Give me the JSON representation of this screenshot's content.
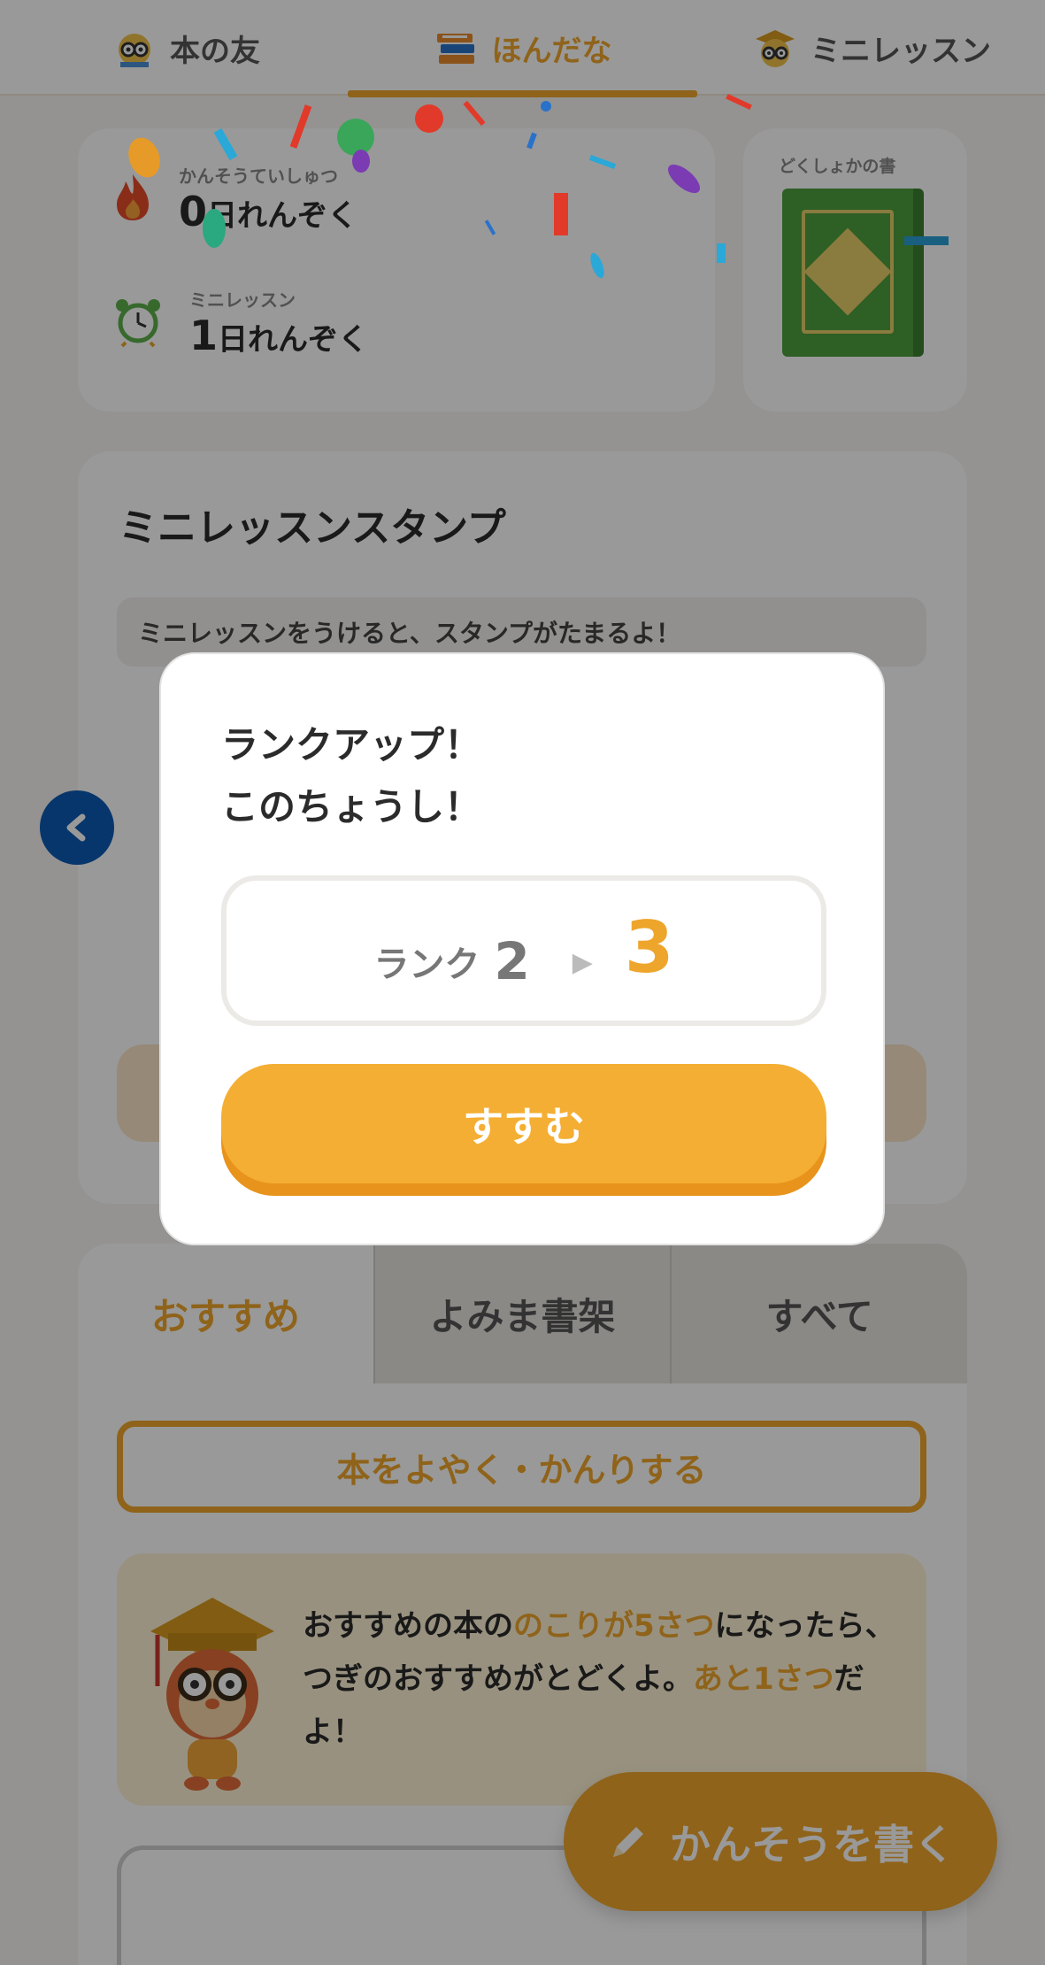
{
  "topnav": {
    "tabs": [
      {
        "label": "本の友",
        "icon": "owl-book-icon"
      },
      {
        "label": "ほんだな",
        "icon": "books-stack-icon"
      },
      {
        "label": "ミニレッスン",
        "icon": "owl-graduate-icon"
      }
    ],
    "active_index": 1
  },
  "streaks": {
    "impressions": {
      "label": "かんそうていしゅつ",
      "count": "0",
      "unit": "日れんぞく",
      "icon": "flame-icon"
    },
    "lessons": {
      "label": "ミニレッスン",
      "count": "1",
      "unit": "日れんぞく",
      "icon": "alarm-clock-icon"
    }
  },
  "reading_book": {
    "label": "どくしょかの書",
    "icon": "green-book-icon"
  },
  "stamp": {
    "title": "ミニレッスンスタンプ",
    "note": "ミニレッスンをうけると、スタンプがたまるよ！"
  },
  "shelf": {
    "tabs": [
      "おすすめ",
      "よみま書架",
      "すべて"
    ],
    "active_tab": 0,
    "reserve_button": "本をよやく・かんりする",
    "info": {
      "p1": "おすすめの本の",
      "h1": "のこりが5さつ",
      "p2": "になったら、つぎのおすすめがとどくよ。",
      "h2": "あと1さつ",
      "p3": "だよ！"
    }
  },
  "fab": {
    "label": "かんそうを書く",
    "icon": "pencil-icon"
  },
  "modal": {
    "line1": "ランクアップ！",
    "line2": "このちょうし！",
    "rank_label": "ランク",
    "rank_from": "2",
    "rank_to": "3",
    "button": "すすむ"
  },
  "colors": {
    "accent": "#eea52c",
    "button": "#f4ae33",
    "nav_arrow": "#0c5bb5"
  }
}
